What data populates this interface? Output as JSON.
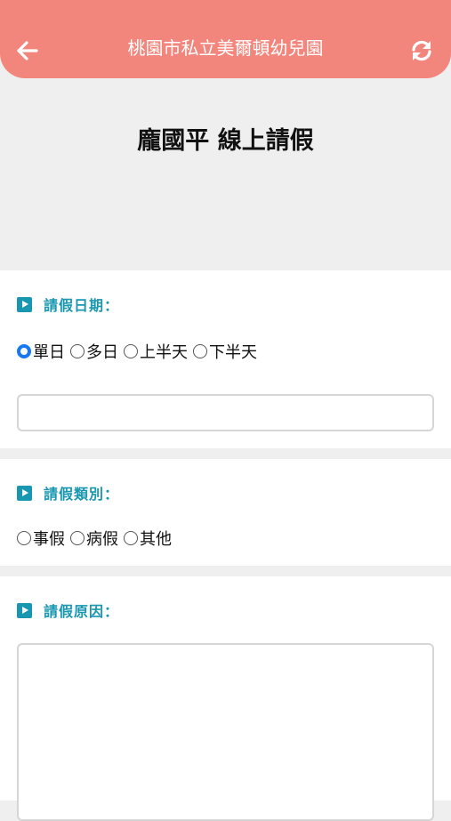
{
  "header": {
    "app_title": "桃園市私立美爾頓幼兒園",
    "back_icon": "arrow-left-icon",
    "refresh_icon": "refresh-icon",
    "color": "#f2867d"
  },
  "page_title": "龐國平 線上請假",
  "leave_date": {
    "label": "請假日期：",
    "options": [
      "單日",
      "多日",
      "上半天",
      "下半天"
    ],
    "selected": "單日",
    "input_value": ""
  },
  "leave_type": {
    "label": "請假類別：",
    "options": [
      "事假",
      "病假",
      "其他"
    ],
    "selected": ""
  },
  "leave_reason": {
    "label": "請假原因：",
    "value": ""
  },
  "accent_color": "#1a97b0"
}
